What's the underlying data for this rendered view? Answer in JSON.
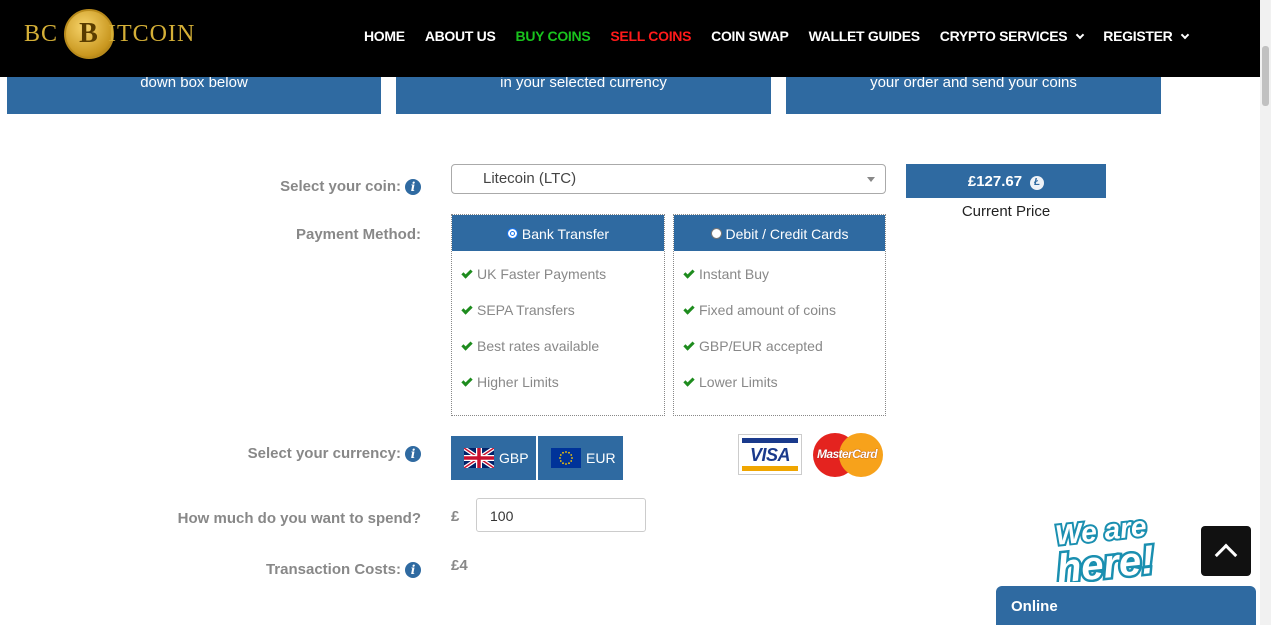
{
  "header": {
    "logo": {
      "left": "BC",
      "coin_letter": "B",
      "right": "ITCOIN"
    },
    "nav": [
      {
        "label": "HOME",
        "color": "#ffffff",
        "has_dropdown": false
      },
      {
        "label": "ABOUT US",
        "color": "#ffffff",
        "has_dropdown": false
      },
      {
        "label": "BUY COINS",
        "color": "#19c31d",
        "has_dropdown": false
      },
      {
        "label": "SELL COINS",
        "color": "#ff1a1a",
        "has_dropdown": false
      },
      {
        "label": "COIN SWAP",
        "color": "#ffffff",
        "has_dropdown": false
      },
      {
        "label": "WALLET GUIDES",
        "color": "#ffffff",
        "has_dropdown": false
      },
      {
        "label": "CRYPTO SERVICES",
        "color": "#ffffff",
        "has_dropdown": true
      },
      {
        "label": "REGISTER",
        "color": "#ffffff",
        "has_dropdown": true
      }
    ]
  },
  "steps": [
    {
      "text": "down box below"
    },
    {
      "text": "in your selected currency"
    },
    {
      "text": "your order and send your coins"
    }
  ],
  "form": {
    "coin_label": "Select your coin:",
    "coin_selected": "Litecoin (LTC)",
    "price": "£127.67",
    "price_coin_icon": "litecoin-icon",
    "price_caption": "Current Price",
    "payment_label": "Payment Method:",
    "payment_methods": [
      {
        "label": "Bank Transfer",
        "selected": true,
        "features": [
          "UK Faster Payments",
          "SEPA Transfers",
          "Best rates available",
          "Higher Limits"
        ]
      },
      {
        "label": "Debit / Credit Cards",
        "selected": false,
        "features": [
          "Instant Buy",
          "Fixed amount of coins",
          "GBP/EUR accepted",
          "Lower Limits"
        ]
      }
    ],
    "currency_label": "Select your currency:",
    "currencies": [
      {
        "code": "GBP",
        "flag": "uk-flag-icon"
      },
      {
        "code": "EUR",
        "flag": "eu-flag-icon"
      }
    ],
    "card_logos": {
      "visa": "VISA",
      "mastercard": "MasterCard"
    },
    "spend_label": "How much do you want to spend?",
    "spend_currency": "£",
    "spend_value": "100",
    "transaction_label": "Transaction Costs:",
    "transaction_value": "£4"
  },
  "widgets": {
    "we_are_here": "We are here!",
    "chat_status": "Online"
  },
  "colors": {
    "accent": "#2f6aa1",
    "buy": "#19c31d",
    "sell": "#ff1a1a",
    "tick": "#1e8c1e"
  }
}
